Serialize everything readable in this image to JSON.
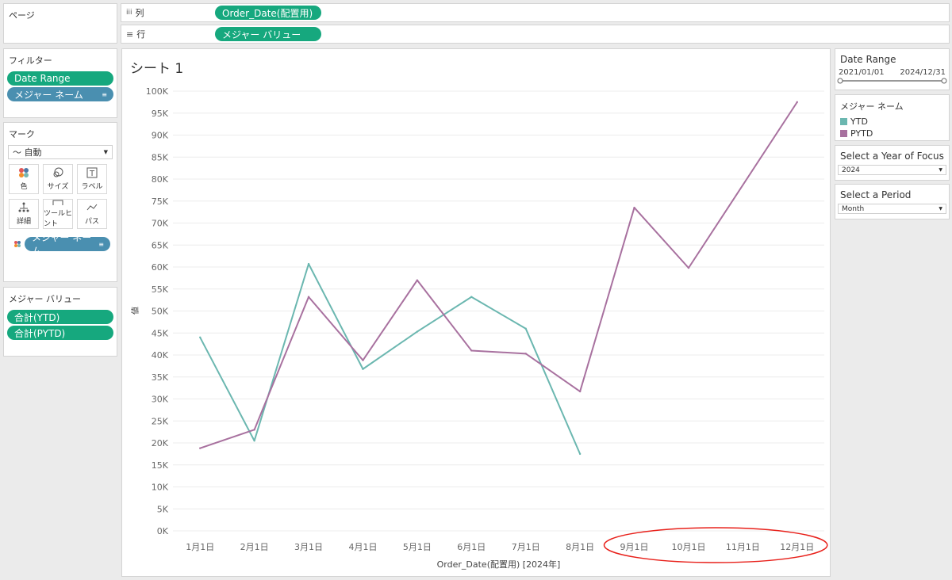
{
  "pages": {
    "title": "ページ"
  },
  "columns_shelf": {
    "label": "列",
    "pill": "Order_Date(配置用)"
  },
  "rows_shelf": {
    "label": "行",
    "pill": "メジャー バリュー"
  },
  "filters": {
    "title": "フィルター",
    "items": [
      "Date Range",
      "メジャー ネーム"
    ]
  },
  "marks": {
    "title": "マーク",
    "type": "自動",
    "buttons": [
      "色",
      "サイズ",
      "ラベル",
      "詳細",
      "ツールヒント",
      "パス"
    ],
    "color_pill": "メジャー ネーム"
  },
  "measure_values": {
    "title": "メジャー バリュー",
    "items": [
      "合計(YTD)",
      "合計(PYTD)"
    ]
  },
  "sheet": {
    "title": "シート 1"
  },
  "date_range": {
    "title": "Date Range",
    "start": "2021/01/01",
    "end": "2024/12/31"
  },
  "legend": {
    "title": "メジャー ネーム",
    "items": [
      "YTD",
      "PYTD"
    ]
  },
  "year_focus": {
    "title": "Select a Year of Focus",
    "value": "2024"
  },
  "period": {
    "title": "Select a Period",
    "value": "Month"
  },
  "colors": {
    "ytd": "#6bb7b0",
    "pytd": "#a8719f",
    "pill_green": "#16a87e",
    "pill_blue": "#4a8fb0",
    "highlight": "#e8201a"
  },
  "chart_data": {
    "type": "line",
    "categories": [
      "1月1日",
      "2月1日",
      "3月1日",
      "4月1日",
      "5月1日",
      "6月1日",
      "7月1日",
      "8月1日",
      "9月1日",
      "10月1日",
      "11月1日",
      "12月1日"
    ],
    "series": [
      {
        "name": "YTD",
        "values": [
          44000,
          20500,
          60700,
          36800,
          45300,
          53200,
          46000,
          17500,
          null,
          null,
          null,
          null
        ]
      },
      {
        "name": "PYTD",
        "values": [
          18800,
          23000,
          53200,
          38800,
          57000,
          41000,
          40300,
          31700,
          73500,
          59800,
          null,
          97500
        ]
      }
    ],
    "yticks": [
      "0K",
      "5K",
      "10K",
      "15K",
      "20K",
      "25K",
      "30K",
      "35K",
      "40K",
      "45K",
      "50K",
      "55K",
      "60K",
      "65K",
      "70K",
      "75K",
      "80K",
      "85K",
      "90K",
      "95K",
      "100K"
    ],
    "ylim": [
      0,
      100000
    ],
    "xlabel": "Order_Date(配置用) [2024年]",
    "ylabel": "値",
    "grid": true
  }
}
